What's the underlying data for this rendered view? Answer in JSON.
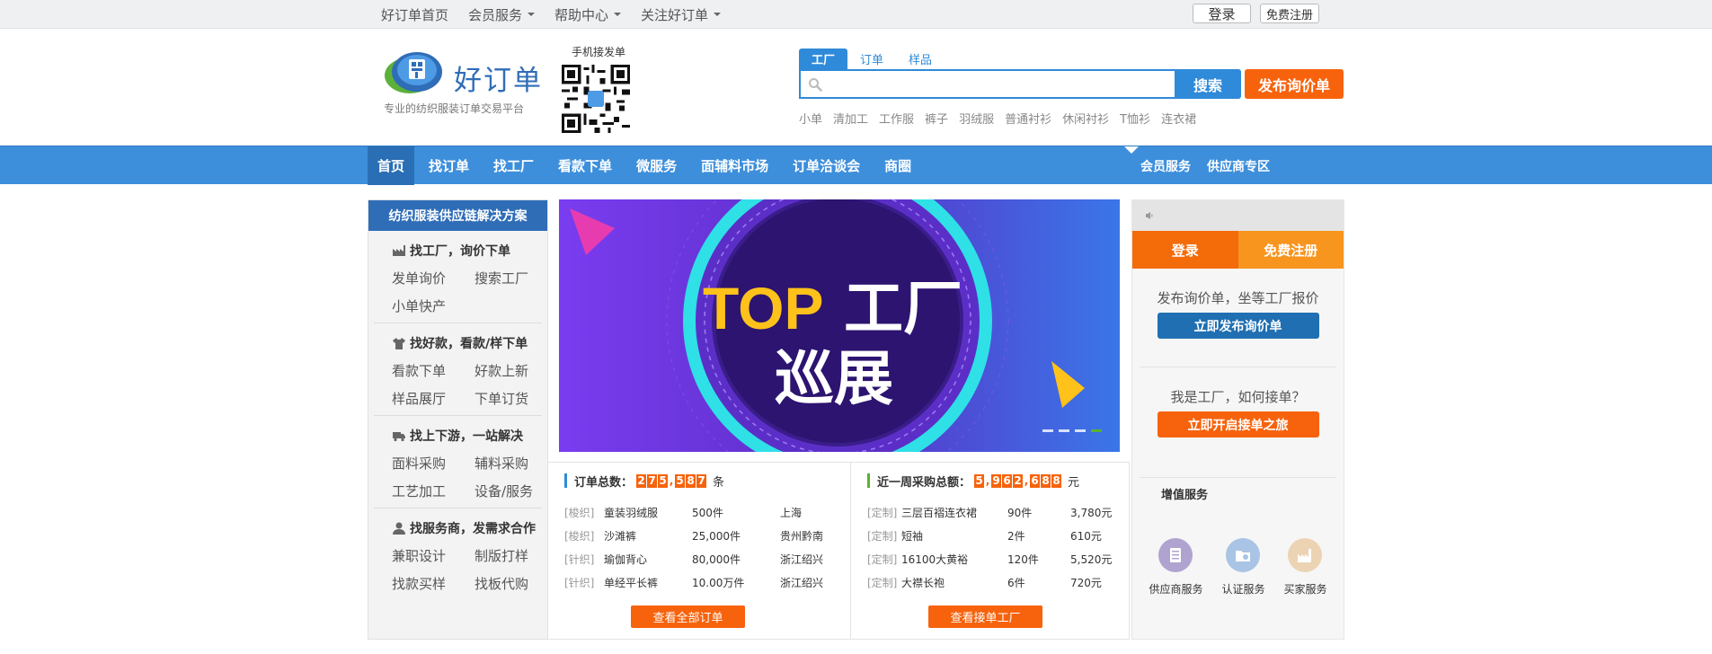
{
  "topbar": {
    "home": "好订单首页",
    "member": "会员服务",
    "help": "帮助中心",
    "follow": "关注好订单",
    "login": "登录",
    "register": "免费注册"
  },
  "header": {
    "logo_text": "好订单",
    "logo_sub": "专业的纺织服装订单交易平台",
    "qr_label": "手机接发单",
    "tabs": [
      "工厂",
      "订单",
      "样品"
    ],
    "search_placeholder": "",
    "search_button": "搜索",
    "publish_button": "发布询价单",
    "hot": [
      "小单",
      "清加工",
      "工作服",
      "裤子",
      "羽绒服",
      "普通衬衫",
      "休闲衬衫",
      "T恤衫",
      "连衣裙"
    ]
  },
  "nav": {
    "items": [
      "首页",
      "找订单",
      "找工厂",
      "看款下单",
      "微服务",
      "面辅料市场",
      "订单洽谈会",
      "商圈"
    ],
    "right": [
      "会员服务",
      "供应商专区"
    ]
  },
  "sidebar": {
    "title": "纺织服装供应链解决方案",
    "groups": [
      {
        "title": "找工厂，询价下单",
        "links": [
          "发单询价",
          "搜索工厂",
          "小单快产"
        ]
      },
      {
        "title": "找好款，看款/样下单",
        "links": [
          "看款下单",
          "好款上新",
          "样品展厅",
          "下单订货"
        ]
      },
      {
        "title": "找上下游，一站解决",
        "links": [
          "面料采购",
          "辅料采购",
          "工艺加工",
          "设备/服务"
        ]
      },
      {
        "title": "找服务商，发需求合作",
        "links": [
          "兼职设计",
          "制版打样",
          "找款买样",
          "找板代购"
        ]
      }
    ]
  },
  "banner": {
    "line1_a": "TOP",
    "line1_b": "工厂",
    "line2": "巡展"
  },
  "orders": {
    "label": "订单总数：",
    "digits": [
      "2",
      "7",
      "5",
      ",",
      "5",
      "8",
      "7"
    ],
    "unit": "条",
    "rows": [
      {
        "tag": "[梭织]",
        "name": "童装羽绒服",
        "qty": "500件",
        "place": "上海"
      },
      {
        "tag": "[梭织]",
        "name": "沙滩裤",
        "qty": "25,000件",
        "place": "贵州黔南"
      },
      {
        "tag": "[针织]",
        "name": "瑜伽背心",
        "qty": "80,000件",
        "place": "浙江绍兴"
      },
      {
        "tag": "[针织]",
        "name": "单经平长裤",
        "qty": "10.00万件",
        "place": "浙江绍兴"
      }
    ],
    "button": "查看全部订单"
  },
  "purchases": {
    "label": "近一周采购总额：",
    "digits": [
      "5",
      ",",
      "9",
      "6",
      "2",
      ",",
      "6",
      "8",
      "8"
    ],
    "unit": "元",
    "rows": [
      {
        "tag": "[定制]",
        "name": "三层百褶连衣裙",
        "qty": "90件",
        "amount": "3,780元"
      },
      {
        "tag": "[定制]",
        "name": "短袖",
        "qty": "2件",
        "amount": "610元"
      },
      {
        "tag": "[定制]",
        "name": "16100大黄裕",
        "qty": "120件",
        "amount": "5,520元"
      },
      {
        "tag": "[定制]",
        "name": "大襟长袍",
        "qty": "6件",
        "amount": "720元"
      }
    ],
    "button": "查看接单工厂"
  },
  "rpanel": {
    "login": "登录",
    "register": "免费注册",
    "promo1_text": "发布询价单，坐等工厂报价",
    "promo1_btn": "立即发布询价单",
    "promo2_text": "我是工厂，如何接单？",
    "promo2_btn": "立即开启接单之旅",
    "vas_title": "增值服务",
    "vas": [
      {
        "label": "供应商服务",
        "color": "#b0a3cf"
      },
      {
        "label": "认证服务",
        "color": "#a9c4e4"
      },
      {
        "label": "买家服务",
        "color": "#ecd3b4"
      }
    ]
  },
  "colors": {
    "brand_blue": "#2f8ad9",
    "nav_blue": "#3d8fdc",
    "orange": "#f7630c",
    "banner_purple": "#5b2fc7",
    "banner_cyan": "#2fe0e6",
    "banner_yellow": "#ffc21a"
  }
}
